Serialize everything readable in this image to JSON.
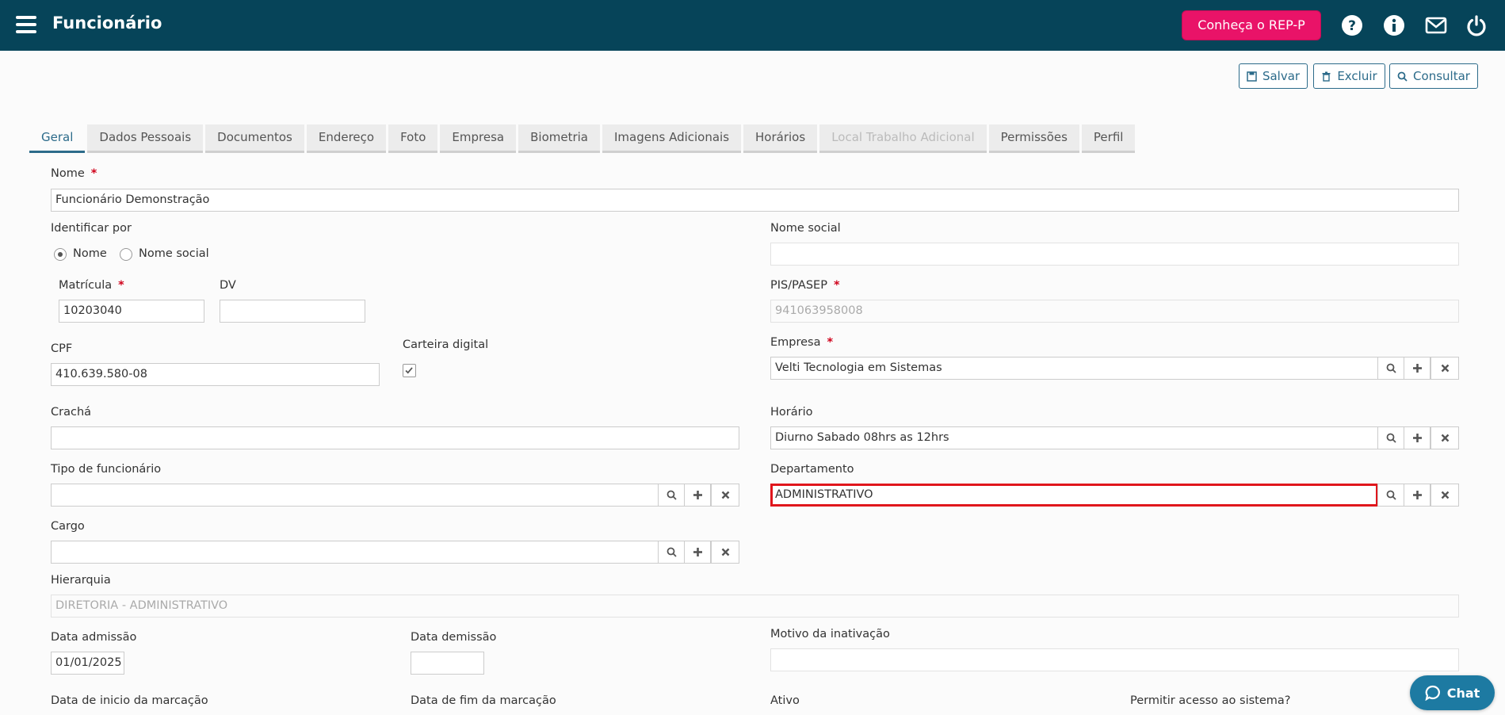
{
  "header": {
    "title": "Funcionário",
    "rep_button": "Conheça o REP-P"
  },
  "actions": {
    "save": "Salvar",
    "delete": "Excluir",
    "search": "Consultar"
  },
  "tabs": [
    {
      "label": "Geral",
      "state": "active"
    },
    {
      "label": "Dados Pessoais"
    },
    {
      "label": "Documentos"
    },
    {
      "label": "Endereço"
    },
    {
      "label": "Foto"
    },
    {
      "label": "Empresa"
    },
    {
      "label": "Biometria"
    },
    {
      "label": "Imagens Adicionais"
    },
    {
      "label": "Horários"
    },
    {
      "label": "Local Trabalho Adicional",
      "state": "disabled"
    },
    {
      "label": "Permissões"
    },
    {
      "label": "Perfil"
    }
  ],
  "form": {
    "nome": {
      "label": "Nome",
      "value": "Funcionário Demonstração"
    },
    "identificar": {
      "label": "Identificar por",
      "option_nome": "Nome",
      "option_social": "Nome social",
      "selected": "Nome"
    },
    "nome_social": {
      "label": "Nome social",
      "value": ""
    },
    "matricula": {
      "label": "Matrícula",
      "value": "10203040"
    },
    "dv": {
      "label": "DV",
      "value": ""
    },
    "pis": {
      "label": "PIS/PASEP",
      "value": "941063958008"
    },
    "cpf": {
      "label": "CPF",
      "value": "410.639.580-08"
    },
    "carteira": {
      "label": "Carteira digital",
      "checked": true
    },
    "empresa": {
      "label": "Empresa",
      "value": "Velti Tecnologia em Sistemas"
    },
    "cracha": {
      "label": "Crachá",
      "value": ""
    },
    "horario": {
      "label": "Horário",
      "value": "Diurno Sabado 08hrs as 12hrs"
    },
    "tipo": {
      "label": "Tipo de funcionário",
      "value": ""
    },
    "departamento": {
      "label": "Departamento",
      "value": "ADMINISTRATIVO"
    },
    "cargo": {
      "label": "Cargo",
      "value": ""
    },
    "hierarquia": {
      "label": "Hierarquia",
      "value": "DIRETORIA - ADMINISTRATIVO"
    },
    "admissao": {
      "label": "Data admissão",
      "value": "01/01/2025"
    },
    "demissao": {
      "label": "Data demissão",
      "value": ""
    },
    "motivo": {
      "label": "Motivo da inativação",
      "value": ""
    },
    "inicio_marcacao": {
      "label": "Data de inicio da marcação"
    },
    "fim_marcacao": {
      "label": "Data de fim da marcação"
    },
    "ativo": {
      "label": "Ativo"
    },
    "acesso": {
      "label": "Permitir acesso ao sistema?"
    }
  },
  "chat": {
    "label": "Chat"
  },
  "colors": {
    "header": "#064459",
    "accent": "#2c6b8a",
    "rep_button": "#e91368",
    "highlight": "#e0161c",
    "chat": "#1d7aa2"
  }
}
